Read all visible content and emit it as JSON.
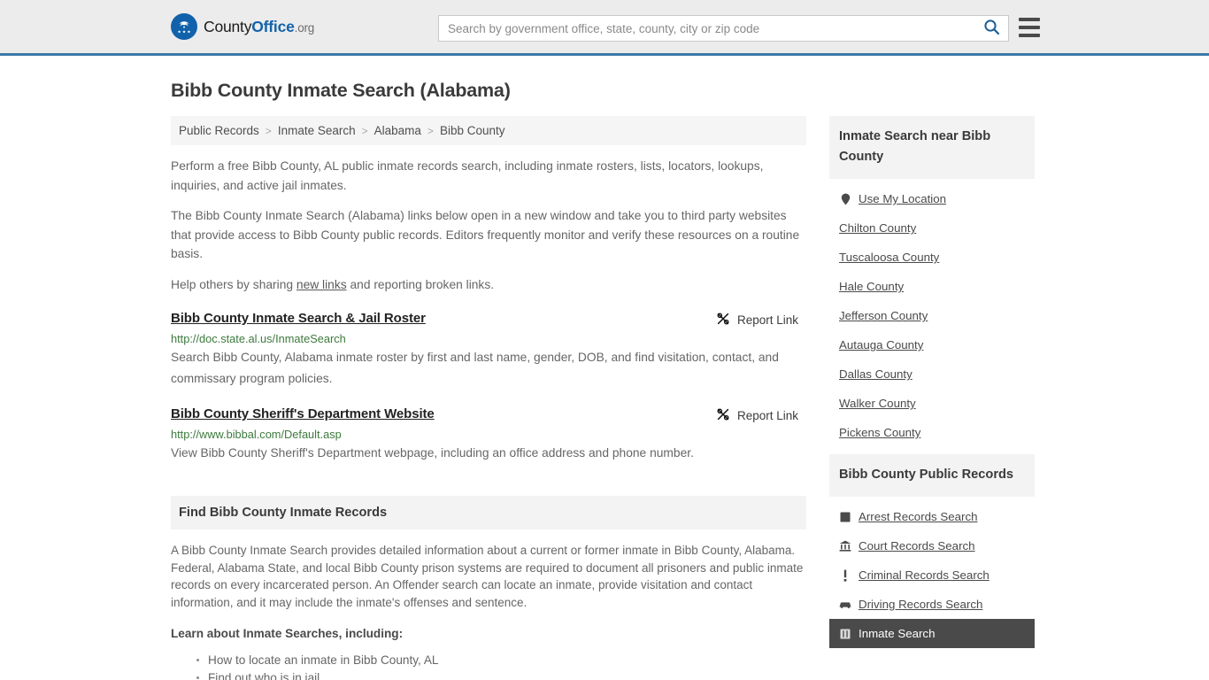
{
  "header": {
    "logo": {
      "part1": "County",
      "part2": "Office",
      "part3": ".org",
      "icon": "eagle-shield-icon"
    },
    "search": {
      "placeholder": "Search by government office, state, county, city or zip code",
      "value": "",
      "button_icon": "search-icon"
    },
    "menu_icon": "hamburger-menu-icon",
    "accent_color": "#3a79a8",
    "background_color": "#ececec"
  },
  "page": {
    "title": "Bibb County Inmate Search (Alabama)"
  },
  "breadcrumb": {
    "separator": ">",
    "items": [
      {
        "label": "Public Records"
      },
      {
        "label": "Inmate Search"
      },
      {
        "label": "Alabama"
      },
      {
        "label": "Bibb County"
      }
    ]
  },
  "intro": {
    "p1": "Perform a free Bibb County, AL public inmate records search, including inmate rosters, lists, locators, lookups, inquiries, and active jail inmates.",
    "p2": "The Bibb County Inmate Search (Alabama) links below open in a new window and take you to third party websites that provide access to Bibb County public records. Editors frequently monitor and verify these resources on a routine basis.",
    "p3_before": "Help others by sharing ",
    "p3_link": "new links",
    "p3_after": " and reporting broken links."
  },
  "results": [
    {
      "title": "Bibb County Inmate Search & Jail Roster",
      "url": "http://doc.state.al.us/InmateSearch",
      "description": "Search Bibb County, Alabama inmate roster by first and last name, gender, DOB, and find visitation, contact, and commissary program policies.",
      "report_label": "Report Link",
      "report_icon": "broken-link-icon"
    },
    {
      "title": "Bibb County Sheriff's Department Website",
      "url": "http://www.bibbal.com/Default.asp",
      "description": "View Bibb County Sheriff's Department webpage, including an office address and phone number.",
      "report_label": "Report Link",
      "report_icon": "broken-link-icon"
    }
  ],
  "section": {
    "heading": "Find Bibb County Inmate Records",
    "body": "A Bibb County Inmate Search provides detailed information about a current or former inmate in Bibb County, Alabama. Federal, Alabama State, and local Bibb County prison systems are required to document all prisoners and public inmate records on every incarcerated person. An Offender search can locate an inmate, provide visitation and contact information, and it may include the inmate's offenses and sentence.",
    "subheading": "Learn about Inmate Searches, including:",
    "bullets": [
      "How to locate an inmate in Bibb County, AL",
      "Find out who is in jail"
    ]
  },
  "sidebar": {
    "nearby": {
      "heading": "Inmate Search near Bibb County",
      "items": [
        {
          "label": "Use My Location",
          "icon": "map-pin-icon"
        },
        {
          "label": "Chilton County",
          "icon": ""
        },
        {
          "label": "Tuscaloosa County",
          "icon": ""
        },
        {
          "label": "Hale County",
          "icon": ""
        },
        {
          "label": "Jefferson County",
          "icon": ""
        },
        {
          "label": "Autauga County",
          "icon": ""
        },
        {
          "label": "Dallas County",
          "icon": ""
        },
        {
          "label": "Walker County",
          "icon": ""
        },
        {
          "label": "Pickens County",
          "icon": ""
        }
      ]
    },
    "public_records": {
      "heading": "Bibb County Public Records",
      "items": [
        {
          "label": "Arrest Records Search",
          "icon": "fingerprint-icon",
          "active": false
        },
        {
          "label": "Court Records Search",
          "icon": "courthouse-icon",
          "active": false
        },
        {
          "label": "Criminal Records Search",
          "icon": "exclamation-icon",
          "active": false
        },
        {
          "label": "Driving Records Search",
          "icon": "car-icon",
          "active": false
        },
        {
          "label": "Inmate Search",
          "icon": "inmate-icon",
          "active": true
        }
      ]
    },
    "active_background": "#4a4a4a"
  }
}
